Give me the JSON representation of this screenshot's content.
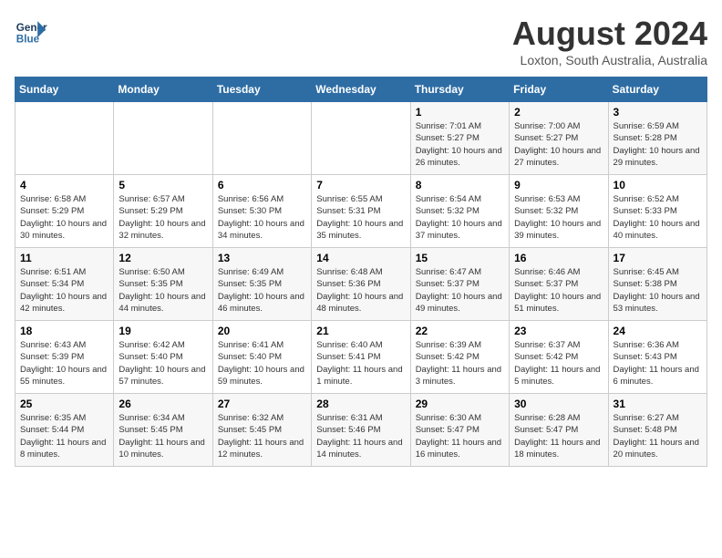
{
  "header": {
    "logo_line1": "General",
    "logo_line2": "Blue",
    "month_year": "August 2024",
    "location": "Loxton, South Australia, Australia"
  },
  "weekdays": [
    "Sunday",
    "Monday",
    "Tuesday",
    "Wednesday",
    "Thursday",
    "Friday",
    "Saturday"
  ],
  "weeks": [
    [
      {
        "day": "",
        "sunrise": "",
        "sunset": "",
        "daylight": ""
      },
      {
        "day": "",
        "sunrise": "",
        "sunset": "",
        "daylight": ""
      },
      {
        "day": "",
        "sunrise": "",
        "sunset": "",
        "daylight": ""
      },
      {
        "day": "",
        "sunrise": "",
        "sunset": "",
        "daylight": ""
      },
      {
        "day": "1",
        "sunrise": "Sunrise: 7:01 AM",
        "sunset": "Sunset: 5:27 PM",
        "daylight": "Daylight: 10 hours and 26 minutes."
      },
      {
        "day": "2",
        "sunrise": "Sunrise: 7:00 AM",
        "sunset": "Sunset: 5:27 PM",
        "daylight": "Daylight: 10 hours and 27 minutes."
      },
      {
        "day": "3",
        "sunrise": "Sunrise: 6:59 AM",
        "sunset": "Sunset: 5:28 PM",
        "daylight": "Daylight: 10 hours and 29 minutes."
      }
    ],
    [
      {
        "day": "4",
        "sunrise": "Sunrise: 6:58 AM",
        "sunset": "Sunset: 5:29 PM",
        "daylight": "Daylight: 10 hours and 30 minutes."
      },
      {
        "day": "5",
        "sunrise": "Sunrise: 6:57 AM",
        "sunset": "Sunset: 5:29 PM",
        "daylight": "Daylight: 10 hours and 32 minutes."
      },
      {
        "day": "6",
        "sunrise": "Sunrise: 6:56 AM",
        "sunset": "Sunset: 5:30 PM",
        "daylight": "Daylight: 10 hours and 34 minutes."
      },
      {
        "day": "7",
        "sunrise": "Sunrise: 6:55 AM",
        "sunset": "Sunset: 5:31 PM",
        "daylight": "Daylight: 10 hours and 35 minutes."
      },
      {
        "day": "8",
        "sunrise": "Sunrise: 6:54 AM",
        "sunset": "Sunset: 5:32 PM",
        "daylight": "Daylight: 10 hours and 37 minutes."
      },
      {
        "day": "9",
        "sunrise": "Sunrise: 6:53 AM",
        "sunset": "Sunset: 5:32 PM",
        "daylight": "Daylight: 10 hours and 39 minutes."
      },
      {
        "day": "10",
        "sunrise": "Sunrise: 6:52 AM",
        "sunset": "Sunset: 5:33 PM",
        "daylight": "Daylight: 10 hours and 40 minutes."
      }
    ],
    [
      {
        "day": "11",
        "sunrise": "Sunrise: 6:51 AM",
        "sunset": "Sunset: 5:34 PM",
        "daylight": "Daylight: 10 hours and 42 minutes."
      },
      {
        "day": "12",
        "sunrise": "Sunrise: 6:50 AM",
        "sunset": "Sunset: 5:35 PM",
        "daylight": "Daylight: 10 hours and 44 minutes."
      },
      {
        "day": "13",
        "sunrise": "Sunrise: 6:49 AM",
        "sunset": "Sunset: 5:35 PM",
        "daylight": "Daylight: 10 hours and 46 minutes."
      },
      {
        "day": "14",
        "sunrise": "Sunrise: 6:48 AM",
        "sunset": "Sunset: 5:36 PM",
        "daylight": "Daylight: 10 hours and 48 minutes."
      },
      {
        "day": "15",
        "sunrise": "Sunrise: 6:47 AM",
        "sunset": "Sunset: 5:37 PM",
        "daylight": "Daylight: 10 hours and 49 minutes."
      },
      {
        "day": "16",
        "sunrise": "Sunrise: 6:46 AM",
        "sunset": "Sunset: 5:37 PM",
        "daylight": "Daylight: 10 hours and 51 minutes."
      },
      {
        "day": "17",
        "sunrise": "Sunrise: 6:45 AM",
        "sunset": "Sunset: 5:38 PM",
        "daylight": "Daylight: 10 hours and 53 minutes."
      }
    ],
    [
      {
        "day": "18",
        "sunrise": "Sunrise: 6:43 AM",
        "sunset": "Sunset: 5:39 PM",
        "daylight": "Daylight: 10 hours and 55 minutes."
      },
      {
        "day": "19",
        "sunrise": "Sunrise: 6:42 AM",
        "sunset": "Sunset: 5:40 PM",
        "daylight": "Daylight: 10 hours and 57 minutes."
      },
      {
        "day": "20",
        "sunrise": "Sunrise: 6:41 AM",
        "sunset": "Sunset: 5:40 PM",
        "daylight": "Daylight: 10 hours and 59 minutes."
      },
      {
        "day": "21",
        "sunrise": "Sunrise: 6:40 AM",
        "sunset": "Sunset: 5:41 PM",
        "daylight": "Daylight: 11 hours and 1 minute."
      },
      {
        "day": "22",
        "sunrise": "Sunrise: 6:39 AM",
        "sunset": "Sunset: 5:42 PM",
        "daylight": "Daylight: 11 hours and 3 minutes."
      },
      {
        "day": "23",
        "sunrise": "Sunrise: 6:37 AM",
        "sunset": "Sunset: 5:42 PM",
        "daylight": "Daylight: 11 hours and 5 minutes."
      },
      {
        "day": "24",
        "sunrise": "Sunrise: 6:36 AM",
        "sunset": "Sunset: 5:43 PM",
        "daylight": "Daylight: 11 hours and 6 minutes."
      }
    ],
    [
      {
        "day": "25",
        "sunrise": "Sunrise: 6:35 AM",
        "sunset": "Sunset: 5:44 PM",
        "daylight": "Daylight: 11 hours and 8 minutes."
      },
      {
        "day": "26",
        "sunrise": "Sunrise: 6:34 AM",
        "sunset": "Sunset: 5:45 PM",
        "daylight": "Daylight: 11 hours and 10 minutes."
      },
      {
        "day": "27",
        "sunrise": "Sunrise: 6:32 AM",
        "sunset": "Sunset: 5:45 PM",
        "daylight": "Daylight: 11 hours and 12 minutes."
      },
      {
        "day": "28",
        "sunrise": "Sunrise: 6:31 AM",
        "sunset": "Sunset: 5:46 PM",
        "daylight": "Daylight: 11 hours and 14 minutes."
      },
      {
        "day": "29",
        "sunrise": "Sunrise: 6:30 AM",
        "sunset": "Sunset: 5:47 PM",
        "daylight": "Daylight: 11 hours and 16 minutes."
      },
      {
        "day": "30",
        "sunrise": "Sunrise: 6:28 AM",
        "sunset": "Sunset: 5:47 PM",
        "daylight": "Daylight: 11 hours and 18 minutes."
      },
      {
        "day": "31",
        "sunrise": "Sunrise: 6:27 AM",
        "sunset": "Sunset: 5:48 PM",
        "daylight": "Daylight: 11 hours and 20 minutes."
      }
    ]
  ]
}
